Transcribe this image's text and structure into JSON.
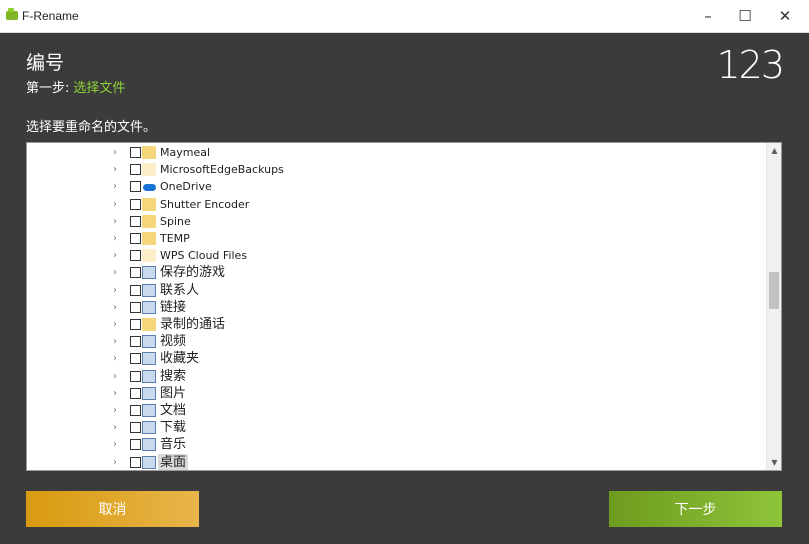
{
  "window": {
    "title": "F-Rename",
    "minimize_symbol": "–",
    "maximize_symbol": "☐",
    "close_symbol": "✕"
  },
  "header": {
    "title": "编号",
    "step_prefix": "第一步:",
    "step_name": "选择文件",
    "logo": "123"
  },
  "instruction": "选择要重命名的文件。",
  "tree": {
    "items": [
      {
        "label": "Maymeal",
        "icon": "folder-icon"
      },
      {
        "label": "MicrosoftEdgeBackups",
        "icon": "folder-faint-icon"
      },
      {
        "label": "OneDrive",
        "icon": "onedrive-cloud-icon"
      },
      {
        "label": "Shutter Encoder",
        "icon": "folder-icon"
      },
      {
        "label": "Spine",
        "icon": "folder-icon"
      },
      {
        "label": "TEMP",
        "icon": "folder-icon"
      },
      {
        "label": "WPS Cloud Files",
        "icon": "folder-faint-icon"
      },
      {
        "label": "保存的游戏",
        "icon": "saved-games-icon"
      },
      {
        "label": "联系人",
        "icon": "contacts-icon"
      },
      {
        "label": "链接",
        "icon": "links-icon"
      },
      {
        "label": "录制的通话",
        "icon": "folder-icon"
      },
      {
        "label": "视频",
        "icon": "videos-icon"
      },
      {
        "label": "收藏夹",
        "icon": "favorites-star-icon"
      },
      {
        "label": "搜索",
        "icon": "search-icon"
      },
      {
        "label": "图片",
        "icon": "pictures-icon"
      },
      {
        "label": "文档",
        "icon": "documents-icon"
      },
      {
        "label": "下载",
        "icon": "downloads-arrow-icon"
      },
      {
        "label": "音乐",
        "icon": "music-note-icon"
      },
      {
        "label": "桌面",
        "icon": "desktop-icon"
      }
    ],
    "selected_index": 18
  },
  "buttons": {
    "cancel": "取消",
    "next": "下一步"
  },
  "colors": {
    "background": "#3b3b3b",
    "accent_green": "#8fd235",
    "cancel_button": "#d89a0f",
    "next_button": "#6e9b1e"
  }
}
